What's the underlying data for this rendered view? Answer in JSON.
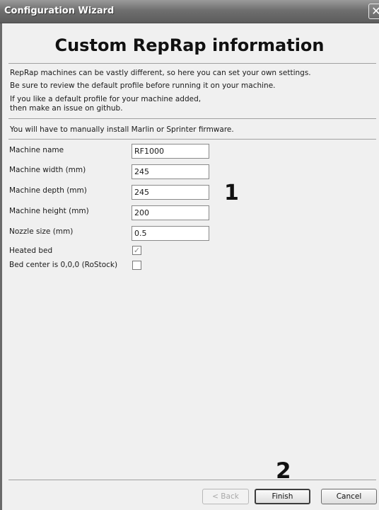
{
  "window": {
    "title": "Configuration Wizard",
    "close_glyph": "✕"
  },
  "page": {
    "heading": "Custom RepRap information",
    "info_lines": [
      "RepRap machines can be vastly different, so here you can set your own settings.",
      "Be sure to review the default profile before running it on your machine.",
      "If you like a default profile for your machine added,",
      "then make an issue on github.",
      "You will have to manually install Marlin or Sprinter firmware."
    ]
  },
  "form": {
    "machine_name": {
      "label": "Machine name",
      "value": "RF1000"
    },
    "machine_width": {
      "label": "Machine width (mm)",
      "value": "245"
    },
    "machine_depth": {
      "label": "Machine depth (mm)",
      "value": "245"
    },
    "machine_height": {
      "label": "Machine height (mm)",
      "value": "200"
    },
    "nozzle_size": {
      "label": "Nozzle size (mm)",
      "value": "0.5"
    },
    "heated_bed": {
      "label": "Heated bed",
      "checked": true,
      "mark": "✓"
    },
    "bed_center": {
      "label": "Bed center is 0,0,0 (RoStock)",
      "checked": false
    }
  },
  "annotations": {
    "marker_1": "1",
    "marker_2": "2"
  },
  "buttons": {
    "back": "< Back",
    "finish": "Finish",
    "cancel": "Cancel"
  }
}
